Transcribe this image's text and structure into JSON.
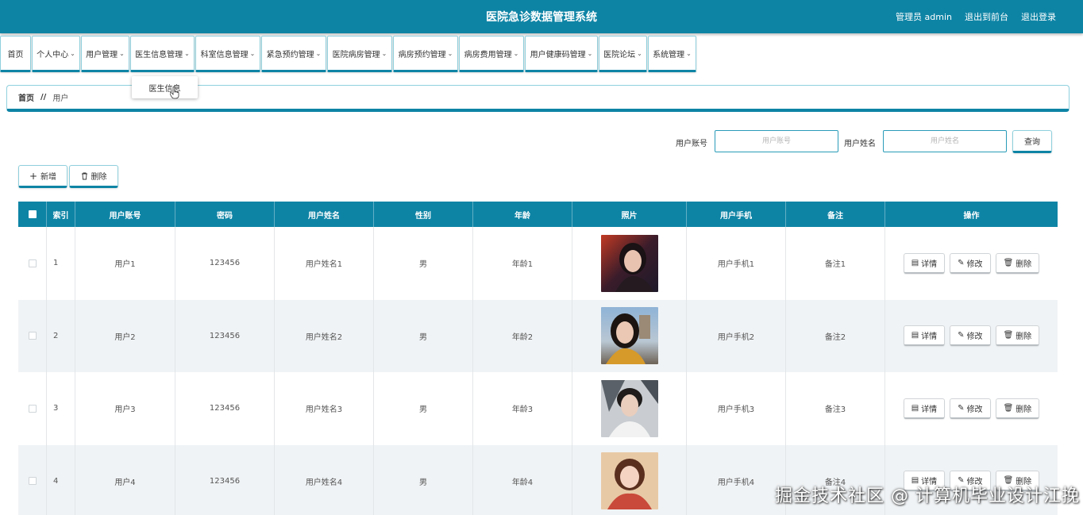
{
  "header": {
    "title": "医院急诊数据管理系统",
    "links": [
      "管理员 admin",
      "退出到前台",
      "退出登录"
    ],
    "color": "#0e84a5"
  },
  "nav": [
    {
      "label": "首页",
      "dropdown": false
    },
    {
      "label": "个人中心",
      "dropdown": true
    },
    {
      "label": "用户管理",
      "dropdown": true
    },
    {
      "label": "医生信息管理",
      "dropdown": true
    },
    {
      "label": "科室信息管理",
      "dropdown": true
    },
    {
      "label": "紧急预约管理",
      "dropdown": true
    },
    {
      "label": "医院病房管理",
      "dropdown": true
    },
    {
      "label": "病房预约管理",
      "dropdown": true
    },
    {
      "label": "病房费用管理",
      "dropdown": true
    },
    {
      "label": "用户健康码管理",
      "dropdown": true
    },
    {
      "label": "医院论坛",
      "dropdown": true
    },
    {
      "label": "系统管理",
      "dropdown": true
    }
  ],
  "dropdown_menu": {
    "items": [
      "医生信息"
    ]
  },
  "breadcrumb": {
    "home": "首页",
    "separator": "//",
    "current": "用户"
  },
  "search": {
    "account_label": "用户账号",
    "account_placeholder": "用户账号",
    "name_label": "用户姓名",
    "name_placeholder": "用户姓名",
    "query_button": "查询"
  },
  "toolbar": {
    "add_label": "新增",
    "delete_label": "删除"
  },
  "table": {
    "columns": [
      "索引",
      "用户账号",
      "密码",
      "用户姓名",
      "性别",
      "年龄",
      "照片",
      "用户手机",
      "备注",
      "操作"
    ],
    "rows": [
      {
        "index": "1",
        "account": "用户1",
        "password": "123456",
        "name": "用户姓名1",
        "gender": "男",
        "age": "年龄1",
        "phone": "用户手机1",
        "note": "备注1"
      },
      {
        "index": "2",
        "account": "用户2",
        "password": "123456",
        "name": "用户姓名2",
        "gender": "男",
        "age": "年龄2",
        "phone": "用户手机2",
        "note": "备注2"
      },
      {
        "index": "3",
        "account": "用户3",
        "password": "123456",
        "name": "用户姓名3",
        "gender": "男",
        "age": "年龄3",
        "phone": "用户手机3",
        "note": "备注3"
      },
      {
        "index": "4",
        "account": "用户4",
        "password": "123456",
        "name": "用户姓名4",
        "gender": "男",
        "age": "年龄4",
        "phone": "用户手机4",
        "note": "备注4"
      }
    ],
    "actions": {
      "detail": "详情",
      "edit": "修改",
      "delete": "删除"
    }
  },
  "watermark": "掘金技术社区 @ 计算机毕业设计江挽"
}
